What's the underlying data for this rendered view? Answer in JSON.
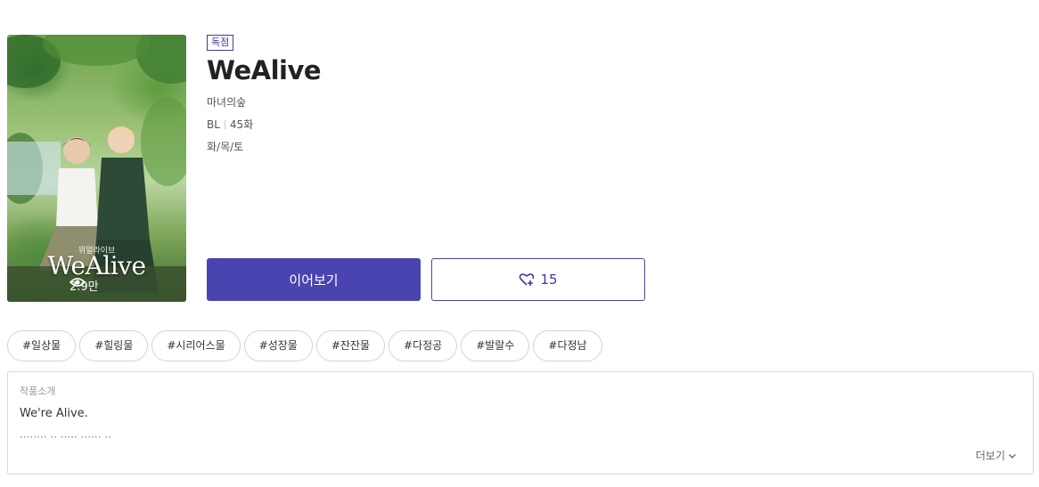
{
  "work": {
    "badge": "독점",
    "title": "WeAlive",
    "author": "마녀의숲",
    "genre": "BL",
    "episodes": "45화",
    "schedule": "화/목/토"
  },
  "cover": {
    "logo_subtitle": "위얼라이브",
    "logo_title": "WeAlive",
    "views": "2.9만"
  },
  "actions": {
    "continue_label": "이어보기",
    "like_count": "15"
  },
  "tags": [
    "#일상물",
    "#힐링물",
    "#시리어스물",
    "#성장물",
    "#잔잔물",
    "#다정공",
    "#발랄수",
    "#다정남"
  ],
  "synopsis": {
    "label": "작품소개",
    "text": "We're Alive.",
    "more_label": "더보기"
  },
  "colors": {
    "accent": "#4a44b0",
    "badge_border": "#3d3aa3"
  },
  "icons": {
    "views": "eye-icon",
    "like": "heart-plus-icon",
    "more": "chevron-down-icon"
  }
}
